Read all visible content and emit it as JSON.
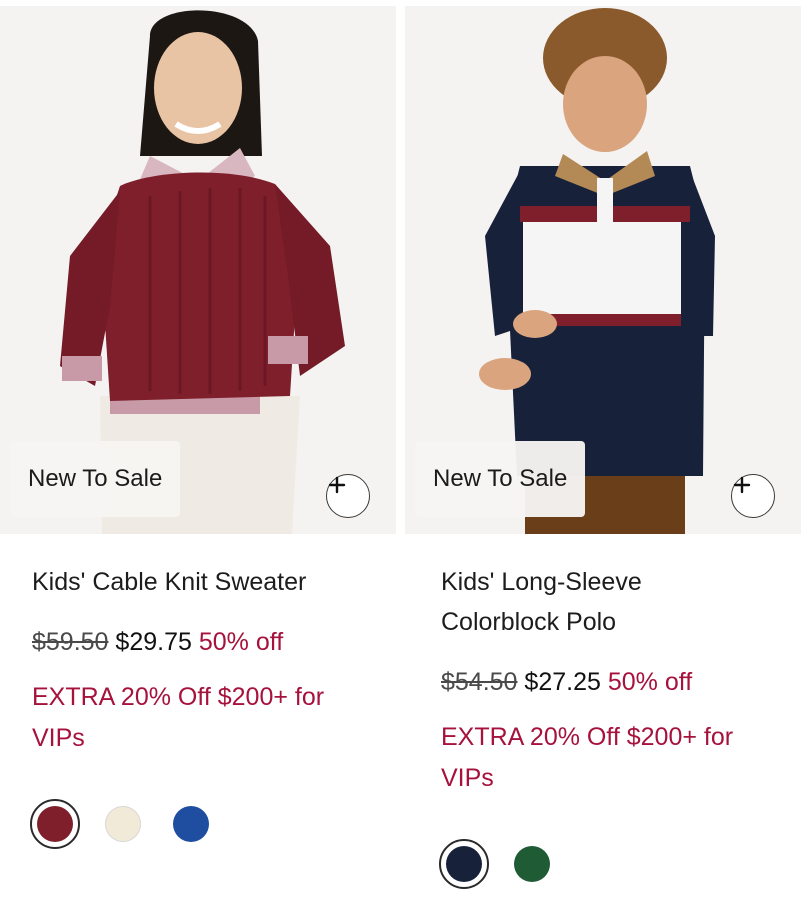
{
  "products": [
    {
      "badge": "New To Sale",
      "title": "Kids' Cable Knit Sweater",
      "original_price": "$59.50",
      "sale_price": "$29.75",
      "discount": "50% off",
      "promo": "EXTRA 20% Off $200+ for VIPs",
      "quick_add_icon": "plus-icon",
      "swatches": [
        {
          "color": "#7e1f2b",
          "selected": true
        },
        {
          "color": "#f1ead8",
          "selected": false
        },
        {
          "color": "#1f4ea1",
          "selected": false
        }
      ]
    },
    {
      "badge": "New To Sale",
      "title": "Kids' Long-Sleeve Colorblock Polo",
      "original_price": "$54.50",
      "sale_price": "$27.25",
      "discount": "50% off",
      "promo": "EXTRA 20% Off $200+ for VIPs",
      "quick_add_icon": "plus-icon",
      "swatches": [
        {
          "color": "#18213a",
          "selected": true
        },
        {
          "color": "#1f5b35",
          "selected": false
        }
      ]
    }
  ],
  "colors": {
    "sale_accent": "#a6123c",
    "photo_background": "#f3f2f0"
  }
}
